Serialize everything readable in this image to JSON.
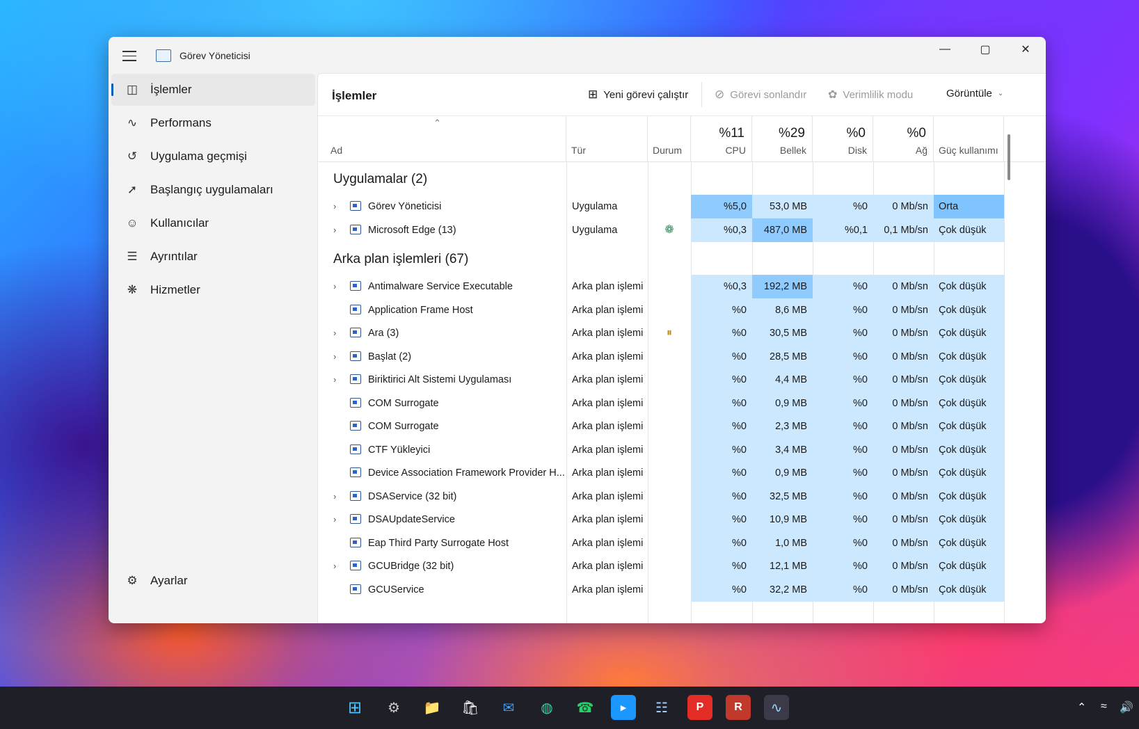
{
  "window": {
    "title": "Görev Yöneticisi"
  },
  "sidebar": {
    "items": [
      {
        "label": "İşlemler",
        "icon": "processes-icon"
      },
      {
        "label": "Performans",
        "icon": "performance-icon"
      },
      {
        "label": "Uygulama geçmişi",
        "icon": "history-icon"
      },
      {
        "label": "Başlangıç uygulamaları",
        "icon": "startup-icon"
      },
      {
        "label": "Kullanıcılar",
        "icon": "users-icon"
      },
      {
        "label": "Ayrıntılar",
        "icon": "details-icon"
      },
      {
        "label": "Hizmetler",
        "icon": "services-icon"
      }
    ],
    "settings_label": "Ayarlar"
  },
  "toolbar": {
    "title": "İşlemler",
    "run_task": "Yeni görevi çalıştır",
    "end_task": "Görevi sonlandır",
    "efficiency": "Verimlilik modu",
    "view": "Görüntüle"
  },
  "columns": {
    "name": "Ad",
    "type": "Tür",
    "status": "Durum",
    "cpu": {
      "pct": "%11",
      "label": "CPU"
    },
    "mem": {
      "pct": "%29",
      "label": "Bellek"
    },
    "disk": {
      "pct": "%0",
      "label": "Disk"
    },
    "net": {
      "pct": "%0",
      "label": "Ağ"
    },
    "power": "Güç kullanımı"
  },
  "groups": {
    "apps": "Uygulamalar (2)",
    "background": "Arka plan işlemleri (67)"
  },
  "apps": [
    {
      "name": "Görev Yöneticisi",
      "type": "Uygulama",
      "cpu": "%5,0",
      "mem": "53,0 MB",
      "disk": "%0",
      "net": "0 Mb/sn",
      "power": "Orta"
    },
    {
      "name": "Microsoft Edge (13)",
      "type": "Uygulama",
      "cpu": "%0,3",
      "mem": "487,0 MB",
      "disk": "%0,1",
      "net": "0,1 Mb/sn",
      "power": "Çok düşük"
    }
  ],
  "background": [
    {
      "name": "Antimalware Service Executable",
      "type": "Arka plan işlemi",
      "cpu": "%0,3",
      "mem": "192,2 MB",
      "disk": "%0",
      "net": "0 Mb/sn",
      "power": "Çok düşük"
    },
    {
      "name": "Application Frame Host",
      "type": "Arka plan işlemi",
      "cpu": "%0",
      "mem": "8,6 MB",
      "disk": "%0",
      "net": "0 Mb/sn",
      "power": "Çok düşük"
    },
    {
      "name": "Ara (3)",
      "type": "Arka plan işlemi",
      "cpu": "%0",
      "mem": "30,5 MB",
      "disk": "%0",
      "net": "0 Mb/sn",
      "power": "Çok düşük"
    },
    {
      "name": "Başlat (2)",
      "type": "Arka plan işlemi",
      "cpu": "%0",
      "mem": "28,5 MB",
      "disk": "%0",
      "net": "0 Mb/sn",
      "power": "Çok düşük"
    },
    {
      "name": "Biriktirici Alt Sistemi Uygulaması",
      "type": "Arka plan işlemi",
      "cpu": "%0",
      "mem": "4,4 MB",
      "disk": "%0",
      "net": "0 Mb/sn",
      "power": "Çok düşük"
    },
    {
      "name": "COM Surrogate",
      "type": "Arka plan işlemi",
      "cpu": "%0",
      "mem": "0,9 MB",
      "disk": "%0",
      "net": "0 Mb/sn",
      "power": "Çok düşük"
    },
    {
      "name": "COM Surrogate",
      "type": "Arka plan işlemi",
      "cpu": "%0",
      "mem": "2,3 MB",
      "disk": "%0",
      "net": "0 Mb/sn",
      "power": "Çok düşük"
    },
    {
      "name": "CTF Yükleyici",
      "type": "Arka plan işlemi",
      "cpu": "%0",
      "mem": "3,4 MB",
      "disk": "%0",
      "net": "0 Mb/sn",
      "power": "Çok düşük"
    },
    {
      "name": "Device Association Framework Provider H...",
      "type": "Arka plan işlemi",
      "cpu": "%0",
      "mem": "0,9 MB",
      "disk": "%0",
      "net": "0 Mb/sn",
      "power": "Çok düşük"
    },
    {
      "name": "DSAService (32 bit)",
      "type": "Arka plan işlemi",
      "cpu": "%0",
      "mem": "32,5 MB",
      "disk": "%0",
      "net": "0 Mb/sn",
      "power": "Çok düşük"
    },
    {
      "name": "DSAUpdateService",
      "type": "Arka plan işlemi",
      "cpu": "%0",
      "mem": "10,9 MB",
      "disk": "%0",
      "net": "0 Mb/sn",
      "power": "Çok düşük"
    },
    {
      "name": "Eap Third Party Surrogate Host",
      "type": "Arka plan işlemi",
      "cpu": "%0",
      "mem": "1,0 MB",
      "disk": "%0",
      "net": "0 Mb/sn",
      "power": "Çok düşük"
    },
    {
      "name": "GCUBridge (32 bit)",
      "type": "Arka plan işlemi",
      "cpu": "%0",
      "mem": "12,1 MB",
      "disk": "%0",
      "net": "0 Mb/sn",
      "power": "Çok düşük"
    },
    {
      "name": "GCUService",
      "type": "Arka plan işlemi",
      "cpu": "%0",
      "mem": "32,2 MB",
      "disk": "%0",
      "net": "0 Mb/sn",
      "power": "Çok düşük"
    }
  ],
  "colors": {
    "light": "#cce8ff",
    "mid": "#b8ddff",
    "strong": "#8fcbff",
    "accent": "#005fb8"
  }
}
